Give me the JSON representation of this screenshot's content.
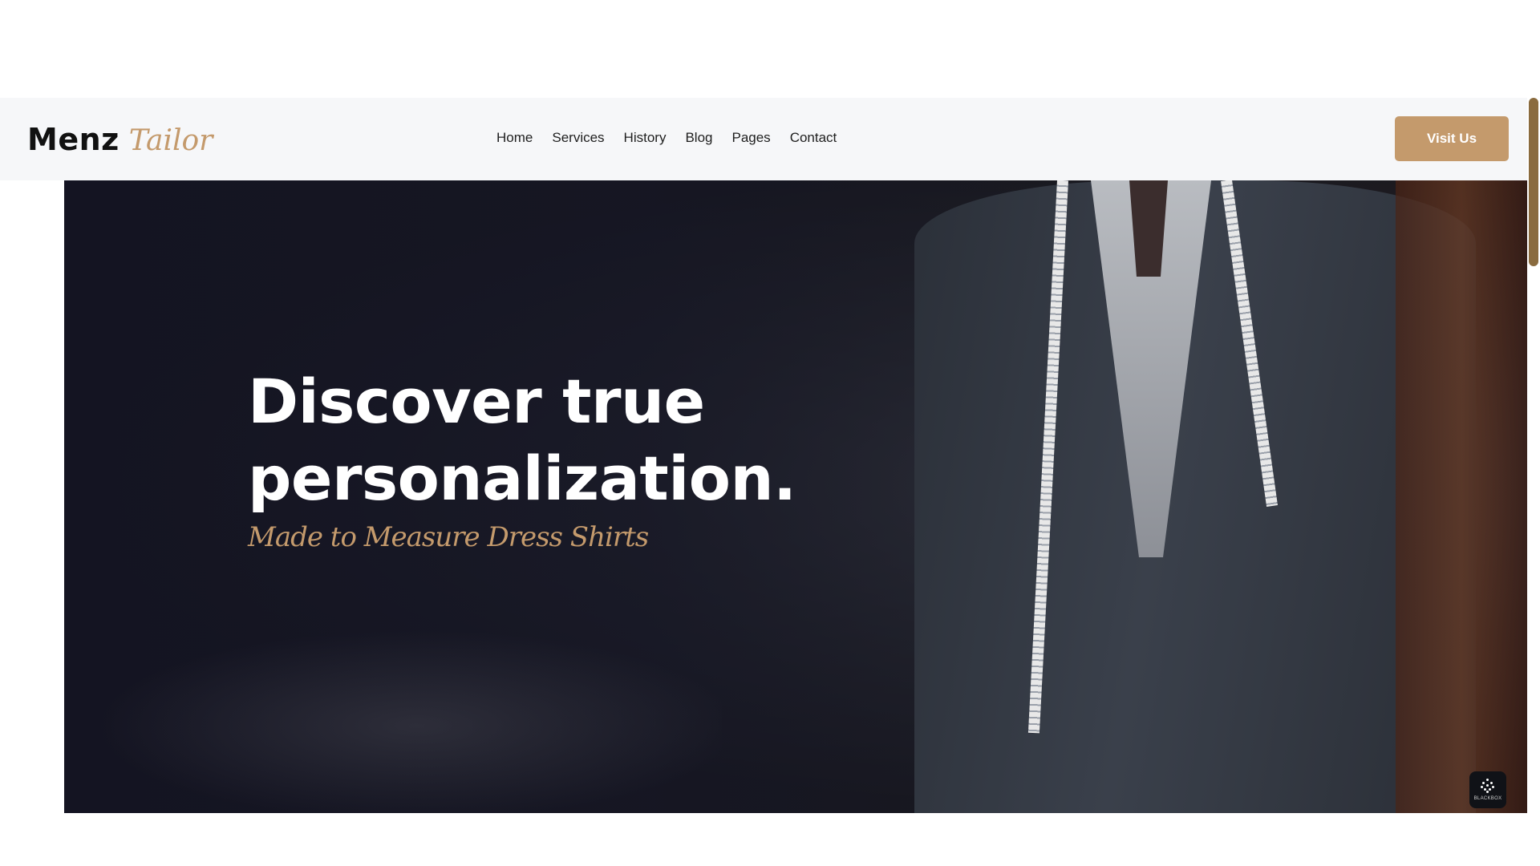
{
  "brand": {
    "name_main": "Menz",
    "name_script": "Tailor",
    "accent_color": "#c49a6c"
  },
  "nav": {
    "items": [
      "Home",
      "Services",
      "History",
      "Blog",
      "Pages",
      "Contact"
    ],
    "cta_label": "Visit Us"
  },
  "hero": {
    "title_line1": "Discover true",
    "title_line2": "personalization.",
    "subtitle": "Made to Measure Dress Shirts"
  },
  "badge": {
    "label": "BLACKBOX",
    "icon": "blackbox-icon"
  }
}
